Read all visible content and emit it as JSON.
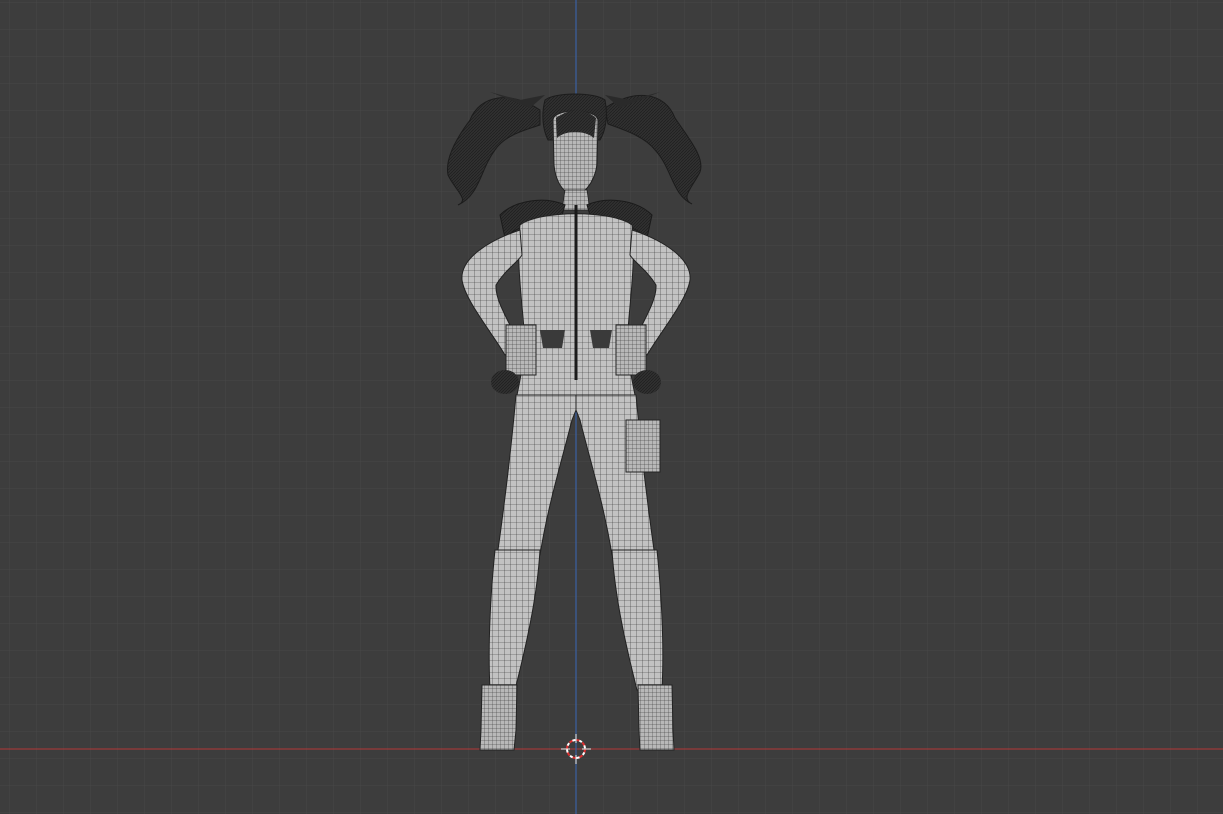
{
  "viewport": {
    "background_color": "#3d3d3d",
    "grid_minor_color": "#484848",
    "grid_major_color": "#545454",
    "x_axis_color": "#9c3a3a",
    "z_axis_color": "#3b5e9c",
    "mesh_fill_color": "#bdbdbd",
    "mesh_wire_color": "#262626",
    "hair_color": "#2b2b2b",
    "cursor_color_primary": "#e03030",
    "cursor_color_secondary": "#ffffff"
  },
  "scene": {
    "object": "character-mesh",
    "display_mode": "wireframe-on-solid",
    "view": "front-orthographic",
    "cursor": "3d-cursor-icon"
  }
}
